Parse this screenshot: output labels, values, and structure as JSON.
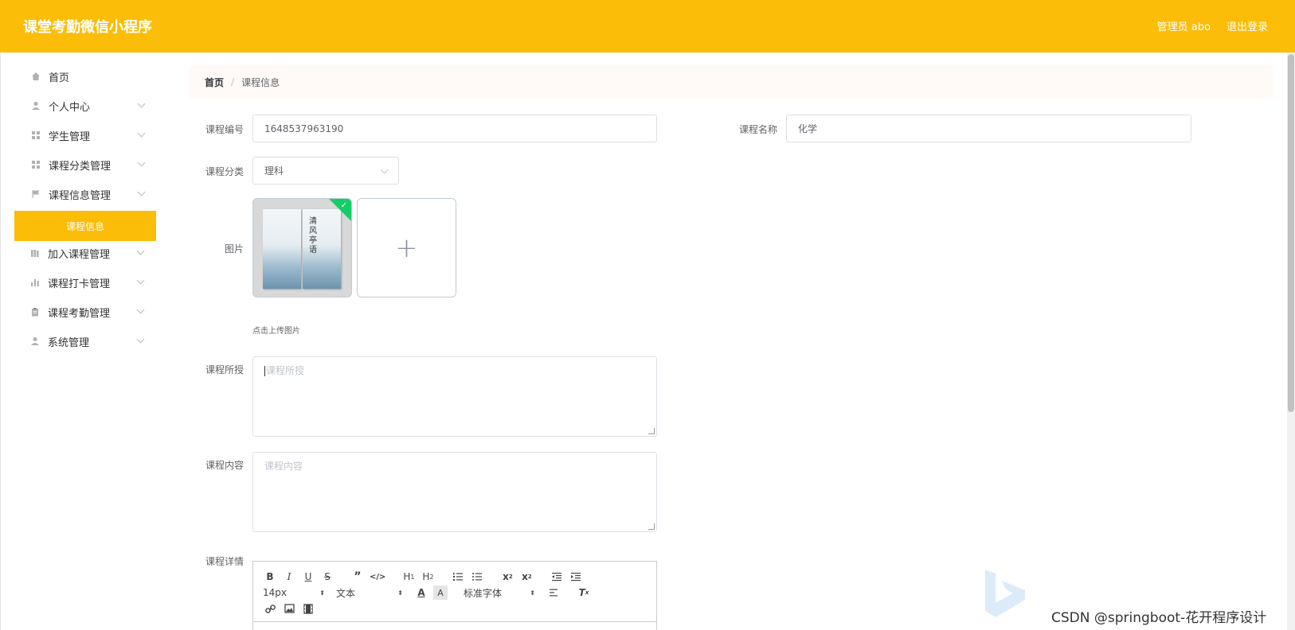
{
  "header": {
    "app_title": "课堂考勤微信小程序",
    "admin_label": "管理员 abo",
    "logout_label": "退出登录"
  },
  "sidebar": {
    "items": [
      {
        "label": "首页",
        "icon": "home-icon"
      },
      {
        "label": "个人中心",
        "icon": "user-icon"
      },
      {
        "label": "学生管理",
        "icon": "grid-icon"
      },
      {
        "label": "课程分类管理",
        "icon": "grid-icon"
      },
      {
        "label": "课程信息管理",
        "icon": "flag-icon"
      },
      {
        "label": "加入课程管理",
        "icon": "books-icon"
      },
      {
        "label": "课程打卡管理",
        "icon": "bar-chart-icon"
      },
      {
        "label": "课程考勤管理",
        "icon": "clipboard-icon"
      },
      {
        "label": "系统管理",
        "icon": "user-icon"
      }
    ],
    "active_sub": "课程信息"
  },
  "breadcrumb": {
    "home": "首页",
    "separator": "/",
    "current": "课程信息"
  },
  "form": {
    "course_no_label": "课程编号",
    "course_no_value": "1648537963190",
    "course_name_label": "课程名称",
    "course_name_value": "化学",
    "category_label": "课程分类",
    "category_value": "理科",
    "image_label": "图片",
    "image_book_title": "清风亭语",
    "upload_tip": "点击上传图片",
    "teacher_label": "课程所授",
    "teacher_placeholder": "课程所授",
    "content_label": "课程内容",
    "content_placeholder": "课程内容",
    "detail_label": "课程详情"
  },
  "editor": {
    "font_size": "14px",
    "heading": "文本",
    "font_family": "标准字体"
  },
  "watermark": "CSDN @springboot-花开程序设计",
  "colors": {
    "accent": "#fbbd08",
    "success": "#13ce66"
  }
}
